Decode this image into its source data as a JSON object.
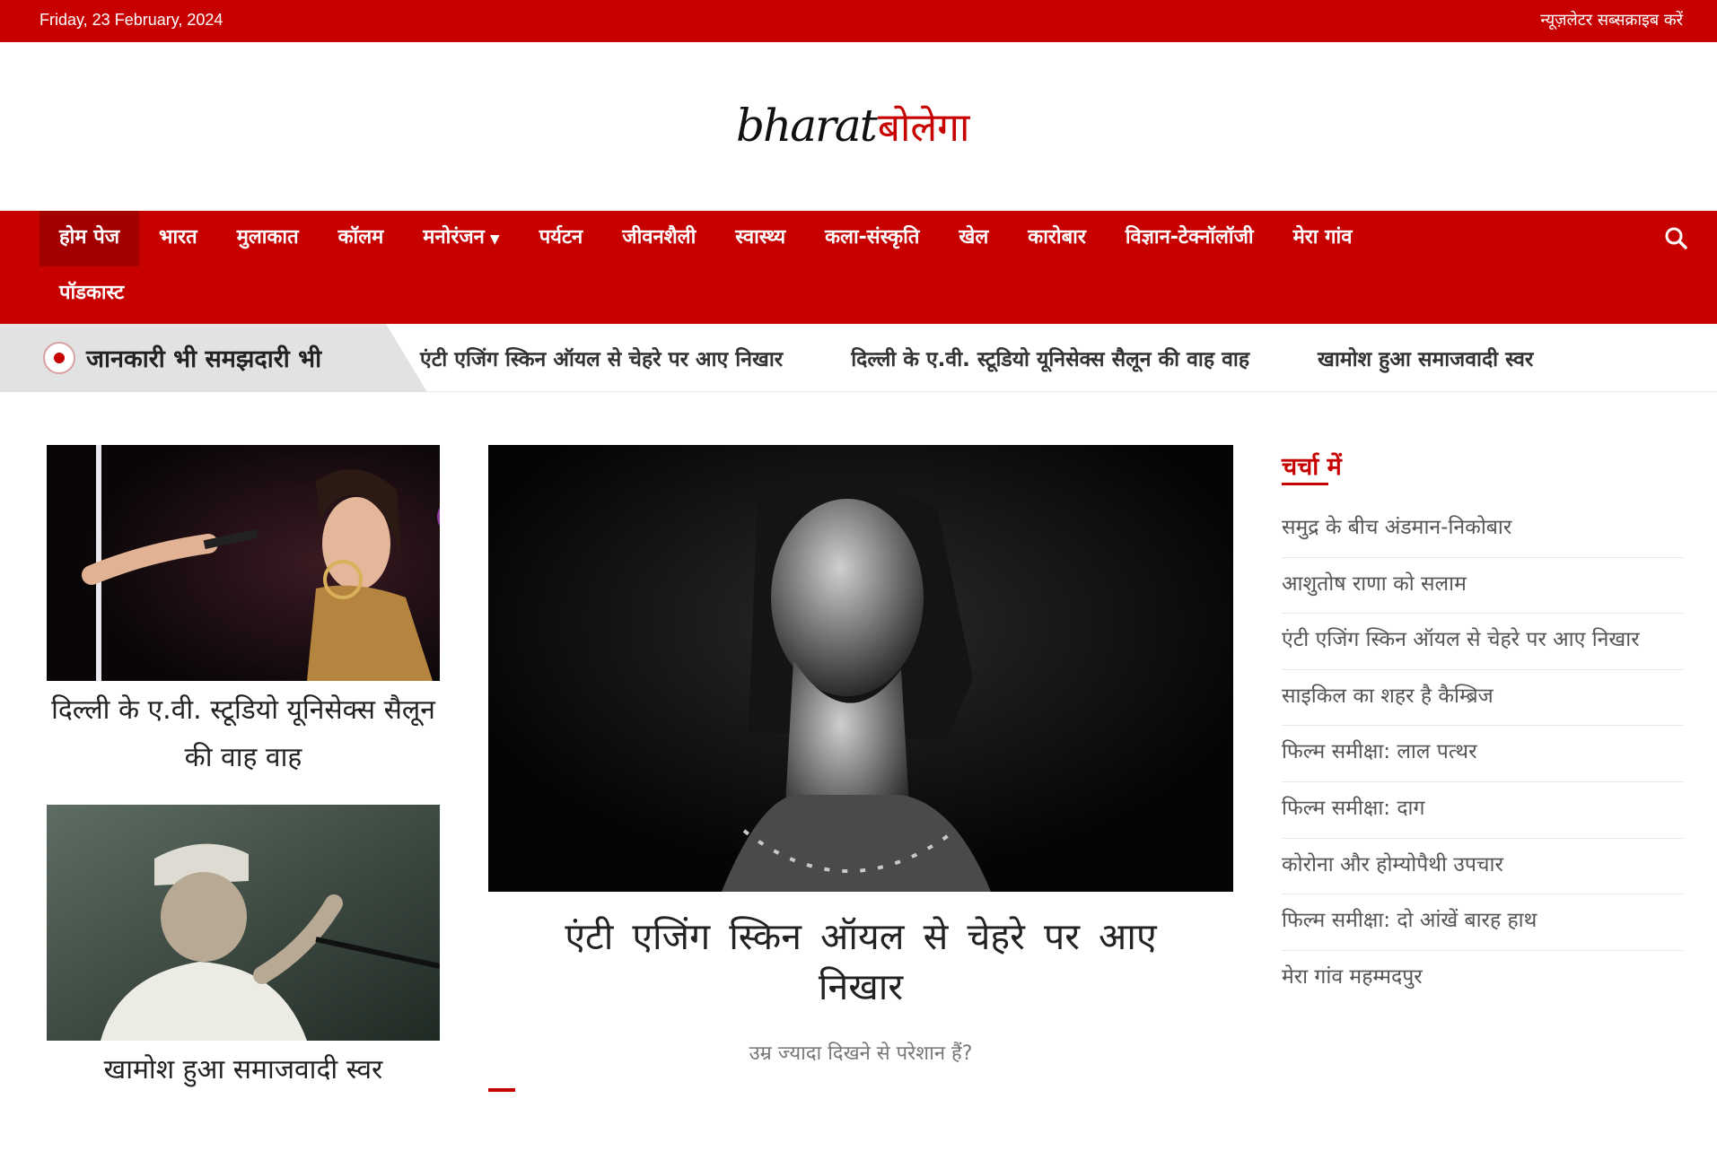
{
  "topbar": {
    "date": "Friday, 23 February, 2024",
    "newsletter": "न्यूज़लेटर सब्सक्राइब करें"
  },
  "logo": {
    "latin": "bharat",
    "devanagari": "बोलेगा"
  },
  "nav": {
    "items": [
      {
        "label": "होम पेज",
        "active": true
      },
      {
        "label": "भारत"
      },
      {
        "label": "मुलाकात"
      },
      {
        "label": "कॉलम"
      },
      {
        "label": "मनोरंजन",
        "dropdown": true
      },
      {
        "label": "पर्यटन"
      },
      {
        "label": "जीवनशैली"
      },
      {
        "label": "स्वास्थ्य"
      },
      {
        "label": "कला-संस्कृति"
      },
      {
        "label": "खेल"
      },
      {
        "label": "कारोबार"
      },
      {
        "label": "विज्ञान-टेक्नॉलॉजी"
      },
      {
        "label": "मेरा गांव"
      },
      {
        "label": "पॉडकास्ट"
      }
    ],
    "search_icon": "search-icon"
  },
  "ticker": {
    "label": "जानकारी भी समझदारी भी",
    "items": [
      "एंटी एजिंग स्किन ऑयल से चेहरे पर आए निखार",
      "दिल्ली के ए.वी. स्टूडियो यूनिसेक्स सैलून की वाह वाह",
      "खामोश हुआ समाजवादी स्वर"
    ]
  },
  "left_cards": [
    {
      "title": "दिल्ली के ए.वी. स्टूडियो यूनिसेक्स सैलून की वाह वाह"
    },
    {
      "title": "खामोश हुआ समाजवादी स्वर"
    }
  ],
  "main_story": {
    "title": "एंटी एजिंग स्किन ऑयल से चेहरे पर आए निखार",
    "excerpt": "उम्र ज्यादा दिखने से परेशान हैं?"
  },
  "sidebar": {
    "heading": "चर्चा में",
    "items": [
      "समुद्र के बीच अंडमान-निकोबार",
      "आशुतोष राणा को सलाम",
      "एंटी एजिंग स्किन ऑयल से चेहरे पर आए निखार",
      "साइकिल का शहर है कैम्ब्रिज",
      "फिल्म समीक्षा: लाल पत्थर",
      "फिल्म समीक्षा: दाग",
      "कोरोना और होम्योपैथी उपचार",
      "फिल्म समीक्षा: दो आंखें बारह हाथ",
      "मेरा गांव महम्मदपुर"
    ]
  },
  "colors": {
    "brand_red": "#c70000",
    "active_nav": "#a30000",
    "ticker_label_bg": "#e2e2e2"
  }
}
